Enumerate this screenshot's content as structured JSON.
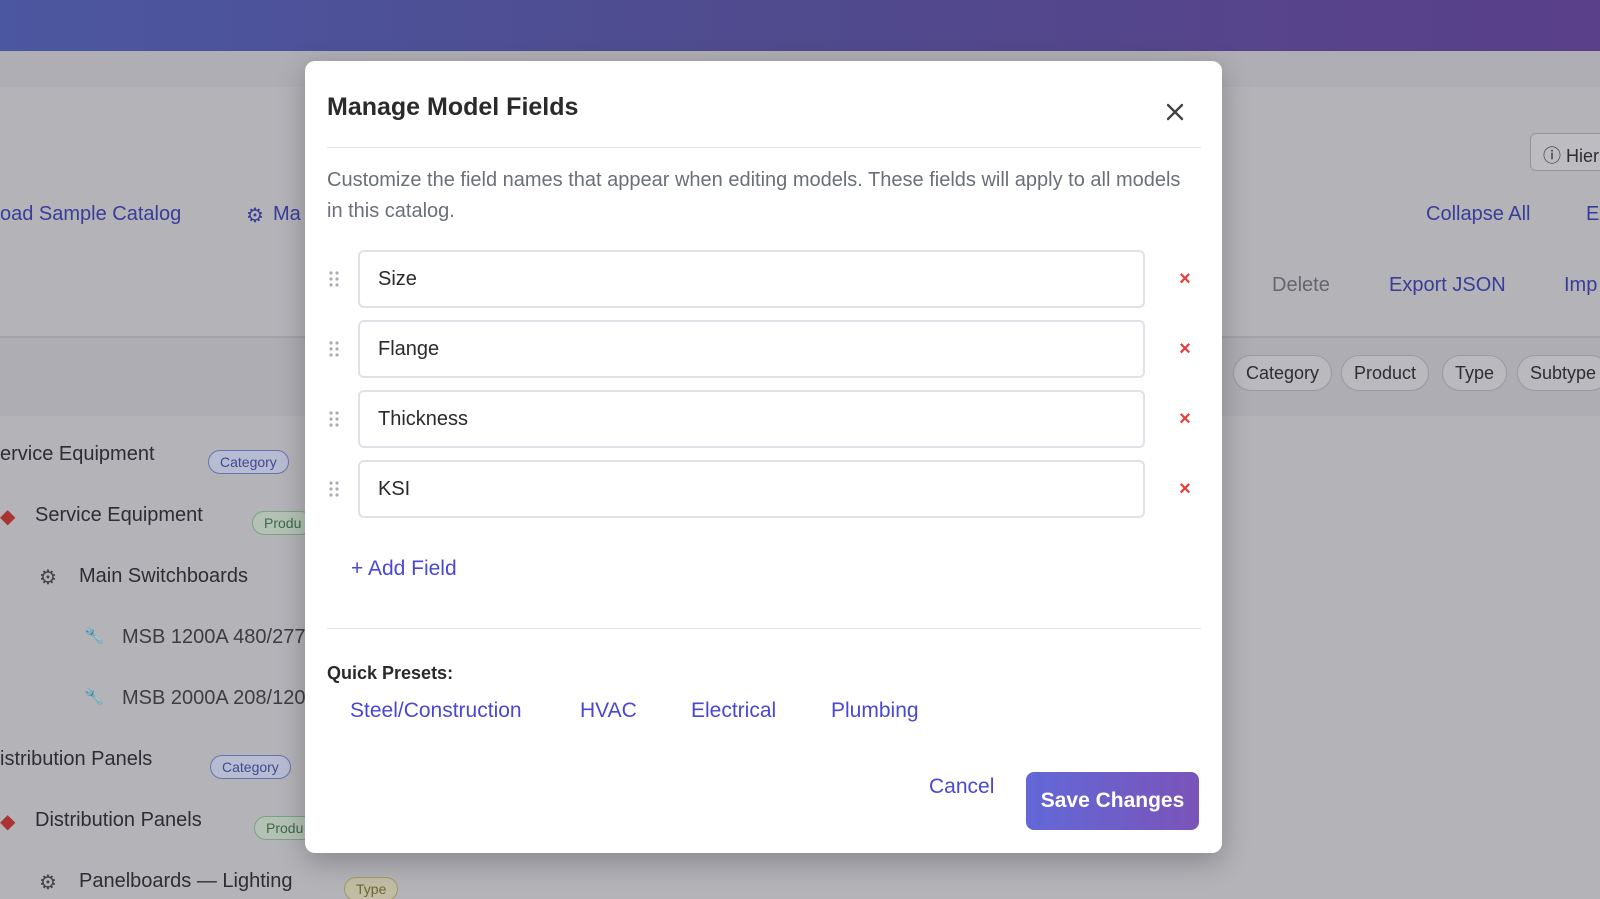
{
  "background": {
    "links": {
      "load_sample": "oad Sample Catalog",
      "manage_partial": "Ma",
      "collapse_all": "Collapse All",
      "expand_partial": "Ex",
      "delete": "Delete",
      "export_json": "Export JSON",
      "import_partial": "Imp"
    },
    "hierarchy_button": "Hier",
    "filter_chips": [
      "Category",
      "Product",
      "Type",
      "Subtype"
    ],
    "tree": [
      {
        "label": "ervice Equipment",
        "badge": "Category"
      },
      {
        "label": "Service Equipment",
        "badge": "Produ"
      },
      {
        "label": "Main Switchboards",
        "badge": ""
      },
      {
        "label": "MSB 1200A 480/277",
        "badge": ""
      },
      {
        "label": "MSB 2000A 208/120",
        "badge": ""
      },
      {
        "label": "istribution Panels",
        "badge": "Category"
      },
      {
        "label": "Distribution Panels",
        "badge": "Produ"
      },
      {
        "label": "Panelboards — Lighting",
        "badge": "Type"
      }
    ]
  },
  "modal": {
    "title": "Manage Model Fields",
    "description": "Customize the field names that appear when editing models. These fields will apply to all models in this catalog.",
    "fields": [
      {
        "value": "Size"
      },
      {
        "value": "Flange"
      },
      {
        "value": "Thickness"
      },
      {
        "value": "KSI"
      }
    ],
    "add_field_label": "+ Add Field",
    "presets_label": "Quick Presets:",
    "presets": [
      "Steel/Construction",
      "HVAC",
      "Electrical",
      "Plumbing"
    ],
    "cancel_label": "Cancel",
    "save_label": "Save Changes",
    "remove_symbol": "×"
  },
  "colors": {
    "accent": "#4a47d6",
    "danger": "#e53e3e",
    "save_gradient_start": "#6368d8",
    "save_gradient_end": "#7a54b8"
  }
}
